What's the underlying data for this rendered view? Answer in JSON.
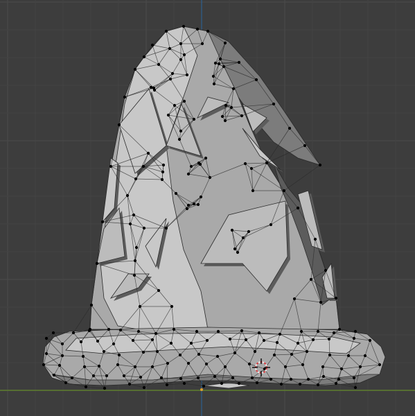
{
  "viewport": {
    "background": "#3d3d3d",
    "grid_minor_color": "#434343",
    "grid_major_color": "#4a4a4a",
    "axis_x_color": "#5f7f2e",
    "axis_z_color": "#2d5f8f"
  },
  "object": {
    "name": "wizard-hat",
    "mode": "edit",
    "mesh_light": "#c8c8c8",
    "mesh_mid": "#a9a9a9",
    "mesh_dark": "#7c7c7c",
    "mesh_shadow": "#5c5c5c",
    "edge_color": "#2a2a2a",
    "vertex_color": "#000000"
  },
  "cursor_3d": {
    "ring_color": "#e8e8e8",
    "dash_color": "#d0353a"
  }
}
